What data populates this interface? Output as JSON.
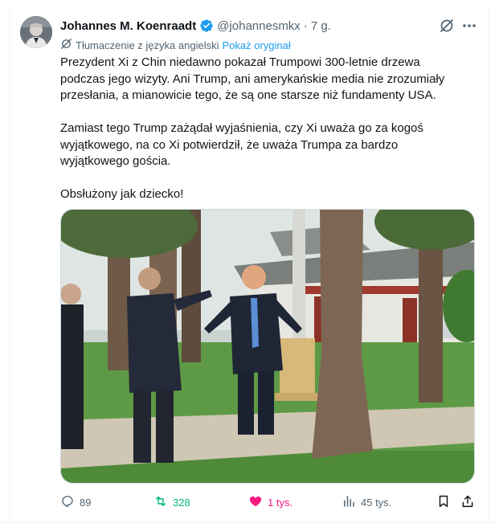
{
  "tweet": {
    "author_name": "Johannes M. Koenraadt",
    "handle": "@johannesmkx",
    "separator": "·",
    "time": "7 g.",
    "translation_label": "Tłumaczenie z języka angielski",
    "show_original": "Pokaż oryginał",
    "paragraphs": [
      [
        "Prezydent Xi z Chin niedawno pokazał Trumpowi 300-letnie drzewa",
        "podczas jego wizyty. Ani Trump, ani amerykańskie media nie zrozumiały",
        "przesłania, a mianowicie tego, że są one starsze niż fundamenty USA."
      ],
      [
        "Zamiast tego Trump zażądał wyjaśnienia, czy Xi uważa go za kogoś",
        "wyjątkowego, na co Xi potwierdził, że uważa Trumpa za bardzo",
        "wyjątkowego gościa."
      ],
      [
        "Obsłużony jak dziecko!"
      ]
    ]
  },
  "actions": {
    "replies": "89",
    "reposts": "328",
    "likes": "1 tys.",
    "views": "45 tys."
  },
  "colors": {
    "verified": "#1d9bf0",
    "repost": "#00ba7c",
    "like": "#f91880",
    "link": "#1d9bf0",
    "muted": "#536471"
  },
  "icons": [
    "verified-badge-icon",
    "grok-icon",
    "more-icon",
    "translate-icon",
    "reply-icon",
    "repost-icon",
    "heart-icon",
    "views-icon",
    "bookmark-icon",
    "share-icon"
  ]
}
